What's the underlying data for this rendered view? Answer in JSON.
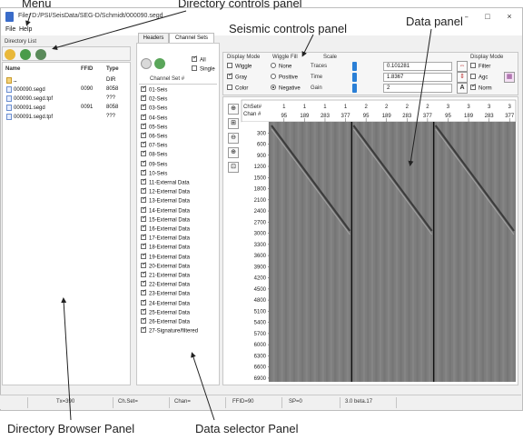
{
  "annotations": {
    "menu": "Menu",
    "directory_controls": "Directory controls panel",
    "seismic_controls": "Seismic controls panel",
    "data_panel": "Data panel",
    "directory_browser": "Directory Browser Panel",
    "data_selector": "Data selector Panel"
  },
  "window": {
    "title": "File: D:/PSI/SeisData/SEG-D/Schmidt/000090.segd",
    "buttons": [
      "–",
      "□",
      "×"
    ]
  },
  "menu": {
    "file": "File",
    "help": "Help"
  },
  "directory": {
    "section_label": "Directory List",
    "columns": {
      "name": "Name",
      "ffid": "FFID",
      "type": "Type"
    },
    "rows": [
      {
        "name": "..",
        "ffid": "",
        "type": "DIR"
      },
      {
        "name": "000090.segd",
        "ffid": "0090",
        "type": "8058"
      },
      {
        "name": "000090.segd.tpf",
        "ffid": "",
        "type": "???"
      },
      {
        "name": "000091.segd",
        "ffid": "0091",
        "type": "8058"
      },
      {
        "name": "000091.segd.tpf",
        "ffid": "",
        "type": "???"
      }
    ]
  },
  "selector": {
    "tabs": [
      "Headers",
      "Channel Sets"
    ],
    "all_label": "All",
    "single_label": "Single",
    "list_header": "Channel Set #",
    "items": [
      "01-Seis",
      "02-Seis",
      "03-Seis",
      "04-Seis",
      "05-Seis",
      "06-Seis",
      "07-Seis",
      "08-Seis",
      "09-Seis",
      "10-Seis",
      "11-External Data",
      "12-External Data",
      "13-External Data",
      "14-External Data",
      "15-External Data",
      "16-External Data",
      "17-External Data",
      "18-External Data",
      "19-External Data",
      "20-External Data",
      "21-External Data",
      "22-External Data",
      "23-External Data",
      "24-External Data",
      "25-External Data",
      "26-External Data",
      "27-Signature/filtered"
    ]
  },
  "controls": {
    "display_mode_title": "Display Mode",
    "wiggle": "Wiggle",
    "gray": "Gray",
    "color": "Color",
    "wiggle_fill_title": "Wiggle Fill",
    "fill_none": "None",
    "fill_positive": "Positive",
    "fill_negative": "Negative",
    "scale_title": "Scale",
    "traces_label": "Traces",
    "traces_value": "0.101281",
    "time_label": "Time",
    "time_value": "1.8367",
    "gain_label": "Gain",
    "gain_value": "2",
    "display_mode2_title": "Display Mode",
    "filter": "Filter",
    "agc": "Agc",
    "norm": "Norm"
  },
  "plot": {
    "header_top": "ChSet#",
    "header_bottom": "Chan #",
    "col_chset": [
      "1",
      "1",
      "1",
      "1",
      "2",
      "2",
      "2",
      "2",
      "3",
      "3",
      "3",
      "3"
    ],
    "col_chan": [
      "95",
      "189",
      "283",
      "377",
      "95",
      "189",
      "283",
      "377",
      "95",
      "189",
      "283",
      "377"
    ],
    "time_ticks": [
      "300",
      "600",
      "900",
      "1200",
      "1500",
      "1800",
      "2100",
      "2400",
      "2700",
      "3000",
      "3300",
      "3600",
      "3900",
      "4200",
      "4500",
      "4800",
      "5100",
      "5400",
      "5700",
      "6000",
      "6300",
      "6600",
      "6900"
    ]
  },
  "status": {
    "tx": "Tx=390",
    "chset": "Ch.Set=",
    "chan": "Chan=",
    "ffid": "FFID=90",
    "sp": "SP=0",
    "version": "3.0 beta.17"
  }
}
